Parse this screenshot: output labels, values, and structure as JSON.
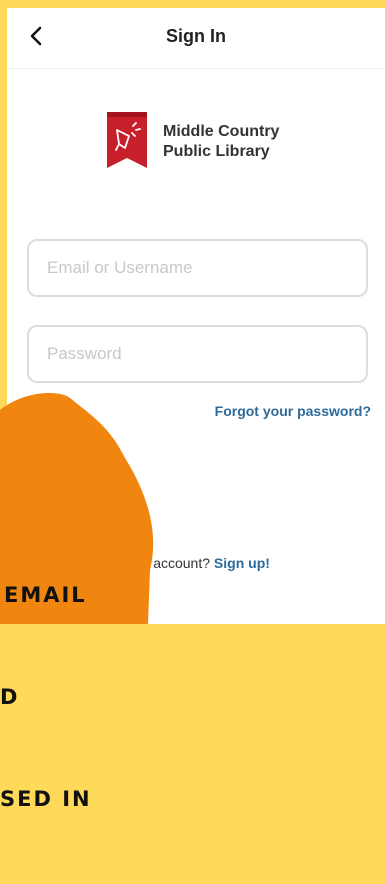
{
  "header": {
    "back_icon": "chevron-left-icon",
    "title": "Sign In"
  },
  "logo": {
    "icon": "library-bookmark-icon",
    "line1": "Middle Country",
    "line2": "Public Library",
    "brand_color": "#c8202b"
  },
  "form": {
    "email_placeholder": "Email or Username",
    "email_value": "",
    "password_placeholder": "Password",
    "password_value": "",
    "forgot_label": "Forgot your password?"
  },
  "signup": {
    "prompt_visible": "e an account?",
    "link_label": "Sign up!"
  },
  "overlay": {
    "line1": "EMAIL",
    "line2": "D",
    "line3": "SED IN",
    "blob_color": "#f0860f"
  },
  "colors": {
    "frame": "#ffd95a",
    "link": "#2d6a99"
  }
}
